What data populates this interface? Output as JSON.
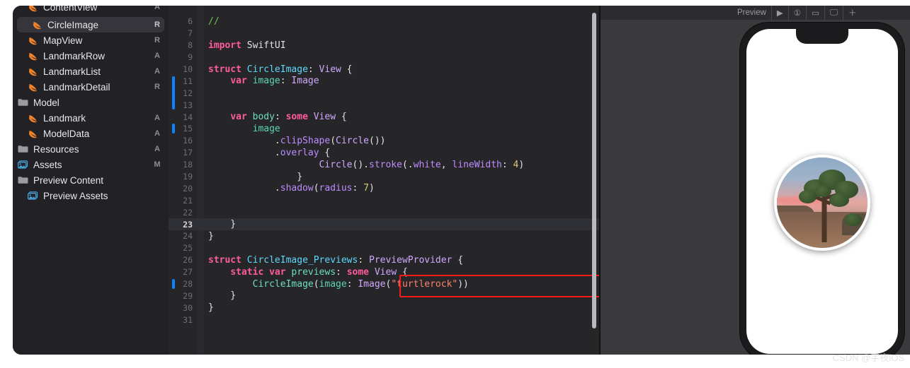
{
  "window": {
    "app": "Xcode"
  },
  "sidebar": {
    "clipped_top_item": {
      "label": "ContentView",
      "badge": "A",
      "icon": "swift-file-icon"
    },
    "items": [
      {
        "label": "CircleImage",
        "badge": "R",
        "icon": "swift-file-icon",
        "indent": 1,
        "selected": true
      },
      {
        "label": "MapView",
        "badge": "R",
        "icon": "swift-file-icon",
        "indent": 1,
        "selected": false
      },
      {
        "label": "LandmarkRow",
        "badge": "A",
        "icon": "swift-file-icon",
        "indent": 1,
        "selected": false
      },
      {
        "label": "LandmarkList",
        "badge": "A",
        "icon": "swift-file-icon",
        "indent": 1,
        "selected": false
      },
      {
        "label": "LandmarkDetail",
        "badge": "R",
        "icon": "swift-file-icon",
        "indent": 1,
        "selected": false
      },
      {
        "label": "Model",
        "badge": "",
        "icon": "folder-icon",
        "indent": 0,
        "selected": false
      },
      {
        "label": "Landmark",
        "badge": "A",
        "icon": "swift-file-icon",
        "indent": 1,
        "selected": false
      },
      {
        "label": "ModelData",
        "badge": "A",
        "icon": "swift-file-icon",
        "indent": 1,
        "selected": false
      },
      {
        "label": "Resources",
        "badge": "A",
        "icon": "folder-icon",
        "indent": 0,
        "selected": false
      },
      {
        "label": "Assets",
        "badge": "M",
        "icon": "assets-icon",
        "indent": 0,
        "selected": false
      },
      {
        "label": "Preview Content",
        "badge": "",
        "icon": "folder-icon",
        "indent": 0,
        "selected": false
      },
      {
        "label": "Preview Assets",
        "badge": "",
        "icon": "assets-icon",
        "indent": 1,
        "selected": false
      }
    ]
  },
  "editor": {
    "current_line": 23,
    "changed_lines": [
      11,
      12,
      13,
      15,
      28
    ],
    "annotation_box": {
      "color": "#f51b1b",
      "target_line": 28
    },
    "lines": [
      {
        "n": 6,
        "tokens": [
          {
            "t": "//",
            "c": "cmt"
          }
        ]
      },
      {
        "n": 7,
        "tokens": []
      },
      {
        "n": 8,
        "tokens": [
          {
            "t": "import",
            "c": "kw"
          },
          {
            "t": " SwiftUI",
            "c": "plain"
          }
        ]
      },
      {
        "n": 9,
        "tokens": []
      },
      {
        "n": 10,
        "tokens": [
          {
            "t": "struct",
            "c": "kw"
          },
          {
            "t": " ",
            "c": "plain"
          },
          {
            "t": "CircleImage",
            "c": "type"
          },
          {
            "t": ": ",
            "c": "plain"
          },
          {
            "t": "View",
            "c": "tpur"
          },
          {
            "t": " {",
            "c": "plain"
          }
        ]
      },
      {
        "n": 11,
        "tokens": [
          {
            "t": "    ",
            "c": "plain"
          },
          {
            "t": "var",
            "c": "kw"
          },
          {
            "t": " ",
            "c": "plain"
          },
          {
            "t": "image",
            "c": "mint"
          },
          {
            "t": ": ",
            "c": "plain"
          },
          {
            "t": "Image",
            "c": "tpur"
          }
        ]
      },
      {
        "n": 12,
        "tokens": []
      },
      {
        "n": 13,
        "tokens": []
      },
      {
        "n": 14,
        "tokens": [
          {
            "t": "    ",
            "c": "plain"
          },
          {
            "t": "var",
            "c": "kw"
          },
          {
            "t": " ",
            "c": "plain"
          },
          {
            "t": "body",
            "c": "tealv"
          },
          {
            "t": ": ",
            "c": "plain"
          },
          {
            "t": "some",
            "c": "kw"
          },
          {
            "t": " ",
            "c": "plain"
          },
          {
            "t": "View",
            "c": "tpur"
          },
          {
            "t": " {",
            "c": "plain"
          }
        ]
      },
      {
        "n": 15,
        "tokens": [
          {
            "t": "        ",
            "c": "plain"
          },
          {
            "t": "image",
            "c": "mint"
          }
        ]
      },
      {
        "n": 16,
        "tokens": [
          {
            "t": "            .",
            "c": "plain"
          },
          {
            "t": "clipShape",
            "c": "mpur"
          },
          {
            "t": "(",
            "c": "plain"
          },
          {
            "t": "Circle",
            "c": "tpur"
          },
          {
            "t": "())",
            "c": "plain"
          }
        ]
      },
      {
        "n": 17,
        "tokens": [
          {
            "t": "            .",
            "c": "plain"
          },
          {
            "t": "overlay",
            "c": "mpur"
          },
          {
            "t": " {",
            "c": "plain"
          }
        ]
      },
      {
        "n": 18,
        "tokens": [
          {
            "t": "                    ",
            "c": "plain"
          },
          {
            "t": "Circle",
            "c": "tpur"
          },
          {
            "t": "().",
            "c": "plain"
          },
          {
            "t": "stroke",
            "c": "mpur"
          },
          {
            "t": "(.",
            "c": "plain"
          },
          {
            "t": "white",
            "c": "mpur"
          },
          {
            "t": ", ",
            "c": "plain"
          },
          {
            "t": "lineWidth",
            "c": "mpur"
          },
          {
            "t": ": ",
            "c": "plain"
          },
          {
            "t": "4",
            "c": "num"
          },
          {
            "t": ")",
            "c": "plain"
          }
        ]
      },
      {
        "n": 19,
        "tokens": [
          {
            "t": "                }",
            "c": "plain"
          }
        ]
      },
      {
        "n": 20,
        "tokens": [
          {
            "t": "            .",
            "c": "plain"
          },
          {
            "t": "shadow",
            "c": "mpur"
          },
          {
            "t": "(",
            "c": "plain"
          },
          {
            "t": "radius",
            "c": "mpur"
          },
          {
            "t": ": ",
            "c": "plain"
          },
          {
            "t": "7",
            "c": "num"
          },
          {
            "t": ")",
            "c": "plain"
          }
        ]
      },
      {
        "n": 21,
        "tokens": []
      },
      {
        "n": 22,
        "tokens": []
      },
      {
        "n": 23,
        "tokens": [
          {
            "t": "    }",
            "c": "plain"
          }
        ]
      },
      {
        "n": 24,
        "tokens": [
          {
            "t": "}",
            "c": "plain"
          }
        ]
      },
      {
        "n": 25,
        "tokens": []
      },
      {
        "n": 26,
        "tokens": [
          {
            "t": "struct",
            "c": "kw"
          },
          {
            "t": " ",
            "c": "plain"
          },
          {
            "t": "CircleImage_Previews",
            "c": "type"
          },
          {
            "t": ": ",
            "c": "plain"
          },
          {
            "t": "PreviewProvider",
            "c": "tpur"
          },
          {
            "t": " {",
            "c": "plain"
          }
        ]
      },
      {
        "n": 27,
        "tokens": [
          {
            "t": "    ",
            "c": "plain"
          },
          {
            "t": "static",
            "c": "kw"
          },
          {
            "t": " ",
            "c": "plain"
          },
          {
            "t": "var",
            "c": "kw"
          },
          {
            "t": " ",
            "c": "plain"
          },
          {
            "t": "previews",
            "c": "tealv"
          },
          {
            "t": ": ",
            "c": "plain"
          },
          {
            "t": "some",
            "c": "kw"
          },
          {
            "t": " ",
            "c": "plain"
          },
          {
            "t": "View",
            "c": "tpur"
          },
          {
            "t": " {",
            "c": "plain"
          }
        ]
      },
      {
        "n": 28,
        "tokens": [
          {
            "t": "        ",
            "c": "plain"
          },
          {
            "t": "CircleImage",
            "c": "tealv"
          },
          {
            "t": "(",
            "c": "plain"
          },
          {
            "t": "image",
            "c": "mint"
          },
          {
            "t": ": ",
            "c": "plain"
          },
          {
            "t": "Image",
            "c": "tpur"
          },
          {
            "t": "(",
            "c": "plain"
          },
          {
            "t": "\"turtlerock\"",
            "c": "str"
          },
          {
            "t": "))",
            "c": "plain"
          }
        ]
      },
      {
        "n": 29,
        "tokens": [
          {
            "t": "    }",
            "c": "plain"
          }
        ]
      },
      {
        "n": 30,
        "tokens": [
          {
            "t": "}",
            "c": "plain"
          }
        ]
      },
      {
        "n": 31,
        "tokens": []
      }
    ]
  },
  "preview": {
    "toolbar": {
      "label": "Preview",
      "items": [
        {
          "name": "preview-label",
          "glyph": "Preview"
        },
        {
          "name": "live-preview-button",
          "glyph": "▶"
        },
        {
          "name": "inspect-button",
          "glyph": "①"
        },
        {
          "name": "device-button",
          "glyph": "▭"
        },
        {
          "name": "display-button",
          "glyph": "🖵"
        },
        {
          "name": "add-preview-button",
          "glyph": "＋"
        }
      ]
    },
    "device": "iPhone",
    "image_asset": "turtlerock",
    "image_description": "Joshua tree at sunset in a circular frame with white border"
  },
  "watermark": {
    "text": "CSDN @宇夜iOS"
  },
  "colors": {
    "accent_blue": "#0a84ff",
    "annotation_red": "#f51b1b",
    "sidebar_bg": "#222226",
    "editor_bg": "#262629",
    "preview_bg": "#3a3a3c",
    "selected_row": "#35353b"
  }
}
